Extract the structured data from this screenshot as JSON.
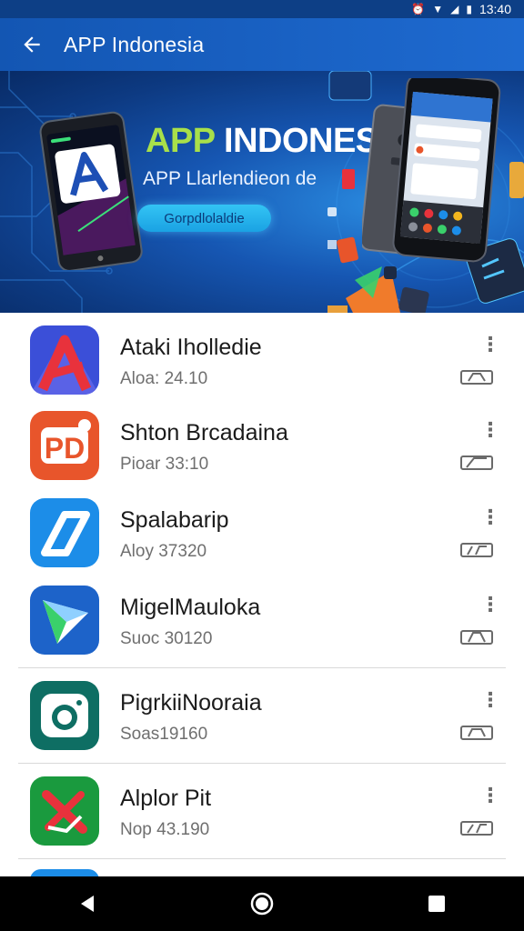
{
  "status_bar": {
    "time": "13:40"
  },
  "app_bar": {
    "title": "APP Indonesia"
  },
  "banner": {
    "title_part1": "APP",
    "title_part2": "INDONESIA",
    "subtitle": "APP Llarlendieon de",
    "cta_label": "Gorpdlolaldie"
  },
  "apps": [
    {
      "name": "Ataki Iholledie",
      "meta": "Aloa: 24.10",
      "icon": "red-letter-a-icon",
      "icon_colors": [
        "#3b4fd8",
        "#e8323c"
      ]
    },
    {
      "name": "Shton Brcadaina",
      "meta": "Pioar 33:10",
      "icon": "orange-pd-badge-icon",
      "icon_colors": [
        "#e8552b",
        "#ffffff"
      ]
    },
    {
      "name": "Spalabarip",
      "meta": "Aloy 37320",
      "icon": "blue-slash-icon",
      "icon_colors": [
        "#1c8de8",
        "#ffffff"
      ]
    },
    {
      "name": "MigelMauloka",
      "meta": "Suoc 30120",
      "icon": "blue-arrow-icon",
      "icon_colors": [
        "#1d63c9",
        "#ffffff"
      ]
    },
    {
      "name": "PigrkiiNooraia",
      "meta": "Soas19160",
      "icon": "teal-camera-icon",
      "icon_colors": [
        "#0e6e63",
        "#ffffff"
      ]
    },
    {
      "name": "Alplor  Pit",
      "meta": "Nop 43.190",
      "icon": "green-x-icon",
      "icon_colors": [
        "#1a9a3e",
        "#e8323c"
      ]
    }
  ],
  "colors": {
    "app_bar": "#1356b3",
    "banner_accent": "#a8e04a",
    "cta": "#1aa2e3"
  }
}
